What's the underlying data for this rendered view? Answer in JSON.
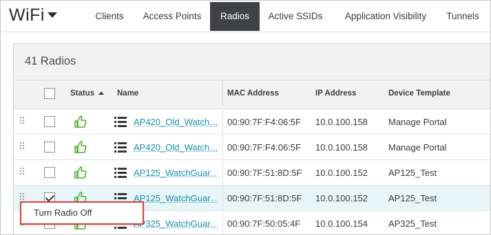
{
  "app": {
    "title": "WiFi"
  },
  "nav": {
    "tabs": [
      {
        "label": "Clients",
        "active": false
      },
      {
        "label": "Access Points",
        "active": false
      },
      {
        "label": "Radios",
        "active": true
      },
      {
        "label": "Active SSIDs",
        "active": false
      },
      {
        "label": "Application Visibility",
        "active": false
      },
      {
        "label": "Tunnels",
        "active": false
      }
    ]
  },
  "radios": {
    "count_label": "41 Radios",
    "columns": {
      "status": "Status",
      "name": "Name",
      "mac": "MAC Address",
      "ip": "IP Address",
      "template": "Device Template"
    },
    "rows": [
      {
        "checked": false,
        "status": "thumbs-up",
        "name": "AP420_Old_Watch…",
        "mac": "00:90:7F:F4:06:5F",
        "ip": "10.0.100.158",
        "template": "Manage Portal"
      },
      {
        "checked": false,
        "status": "thumbs-up",
        "name": "AP420_Old_Watch…",
        "mac": "00:90:7F:F4:06:5F",
        "ip": "10.0.100.158",
        "template": "Manage Portal"
      },
      {
        "checked": false,
        "status": "thumbs-up",
        "name": "AP125_WatchGuar…",
        "mac": "00:90:7F:51:8D:5F",
        "ip": "10.0.100.152",
        "template": "AP125_Test"
      },
      {
        "checked": true,
        "status": "thumbs-up",
        "name": "AP125_WatchGuar…",
        "mac": "00:90:7F:51:8D:5F",
        "ip": "10.0.100.152",
        "template": "AP125_Test"
      },
      {
        "checked": false,
        "status": "thumbs-up",
        "name": "AP325_WatchGuar…",
        "mac": "00:90:7F:50:05:4F",
        "ip": "10.0.100.154",
        "template": "AP325_Test"
      }
    ]
  },
  "context_menu": {
    "item": "Turn Radio Off"
  },
  "colors": {
    "active_tab": "#3d4148",
    "link": "#1a8fa8",
    "status_ok": "#4caf2a",
    "highlight_border": "#d94040"
  },
  "icons": {
    "brand_caret": "caret-down-icon",
    "drag": "drag-handle-icon",
    "status": "thumbs-up-icon",
    "row_menu": "list-icon",
    "sort": "sort-asc-icon"
  }
}
